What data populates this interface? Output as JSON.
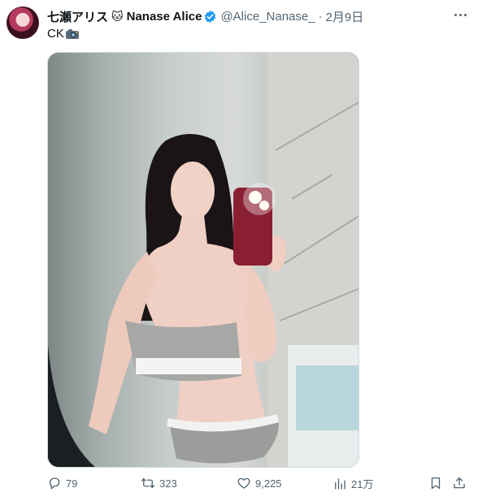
{
  "tweet": {
    "display_name": "七瀬アリス",
    "emoji": "🐱",
    "display_name_latin": "Nanase Alice",
    "handle": "@Alice_Nanase_",
    "separator": "·",
    "date": "2月9日",
    "text": "CK",
    "verified_color": "#1d9bf0"
  },
  "media": {
    "icon": "photo-mirror-selfie"
  },
  "actions": {
    "reply_count": "79",
    "retweet_count": "323",
    "like_count": "9,225",
    "views_count": "21万"
  }
}
